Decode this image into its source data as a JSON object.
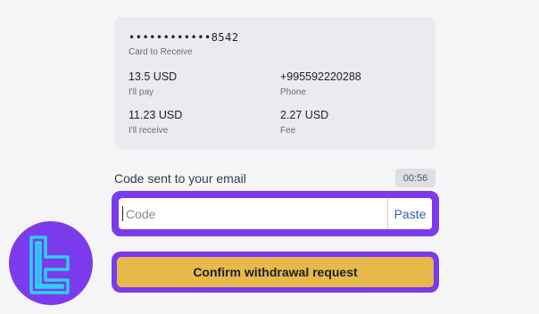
{
  "summary": {
    "card_number": "••••••••••••8542",
    "card_caption": "Card to Receive",
    "pay_amount": "13.5 USD",
    "pay_caption": "I'll pay",
    "phone": "+995592220288",
    "phone_caption": "Phone",
    "receive_amount": "11.23 USD",
    "receive_caption": "I'll receive",
    "fee_amount": "2.27 USD",
    "fee_caption": "Fee"
  },
  "verification": {
    "label": "Code sent to your email",
    "timer": "00:56",
    "placeholder": "Code",
    "paste_label": "Paste"
  },
  "actions": {
    "confirm_label": "Confirm withdrawal request"
  },
  "colors": {
    "highlight": "#7c3aed",
    "confirm_button": "#e7b94b",
    "logo_stroke": "#27d3f0"
  },
  "logo": {
    "icon": "brand-logo-icon"
  }
}
